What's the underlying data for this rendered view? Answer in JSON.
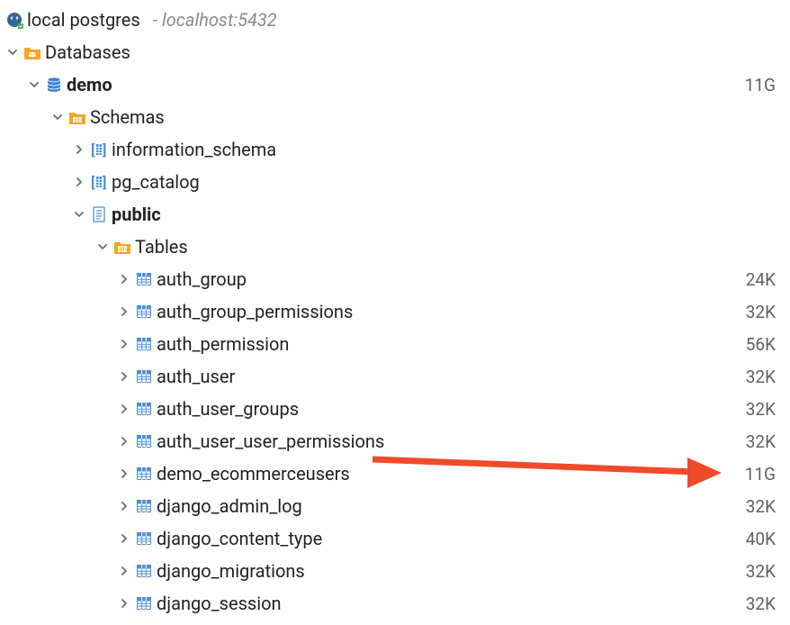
{
  "connection": {
    "name": "local postgres",
    "host": "- localhost:5432"
  },
  "databasesLabel": "Databases",
  "database": {
    "name": "demo",
    "size": "11G"
  },
  "schemasLabel": "Schemas",
  "schemas": {
    "info": "information_schema",
    "pgcat": "pg_catalog",
    "public": "public"
  },
  "tablesLabel": "Tables",
  "tables": [
    {
      "name": "auth_group",
      "size": "24K"
    },
    {
      "name": "auth_group_permissions",
      "size": "32K"
    },
    {
      "name": "auth_permission",
      "size": "56K"
    },
    {
      "name": "auth_user",
      "size": "32K"
    },
    {
      "name": "auth_user_groups",
      "size": "32K"
    },
    {
      "name": "auth_user_user_permissions",
      "size": "32K"
    },
    {
      "name": "demo_ecommerceusers",
      "size": "11G"
    },
    {
      "name": "django_admin_log",
      "size": "32K"
    },
    {
      "name": "django_content_type",
      "size": "40K"
    },
    {
      "name": "django_migrations",
      "size": "32K"
    },
    {
      "name": "django_session",
      "size": "32K"
    }
  ]
}
